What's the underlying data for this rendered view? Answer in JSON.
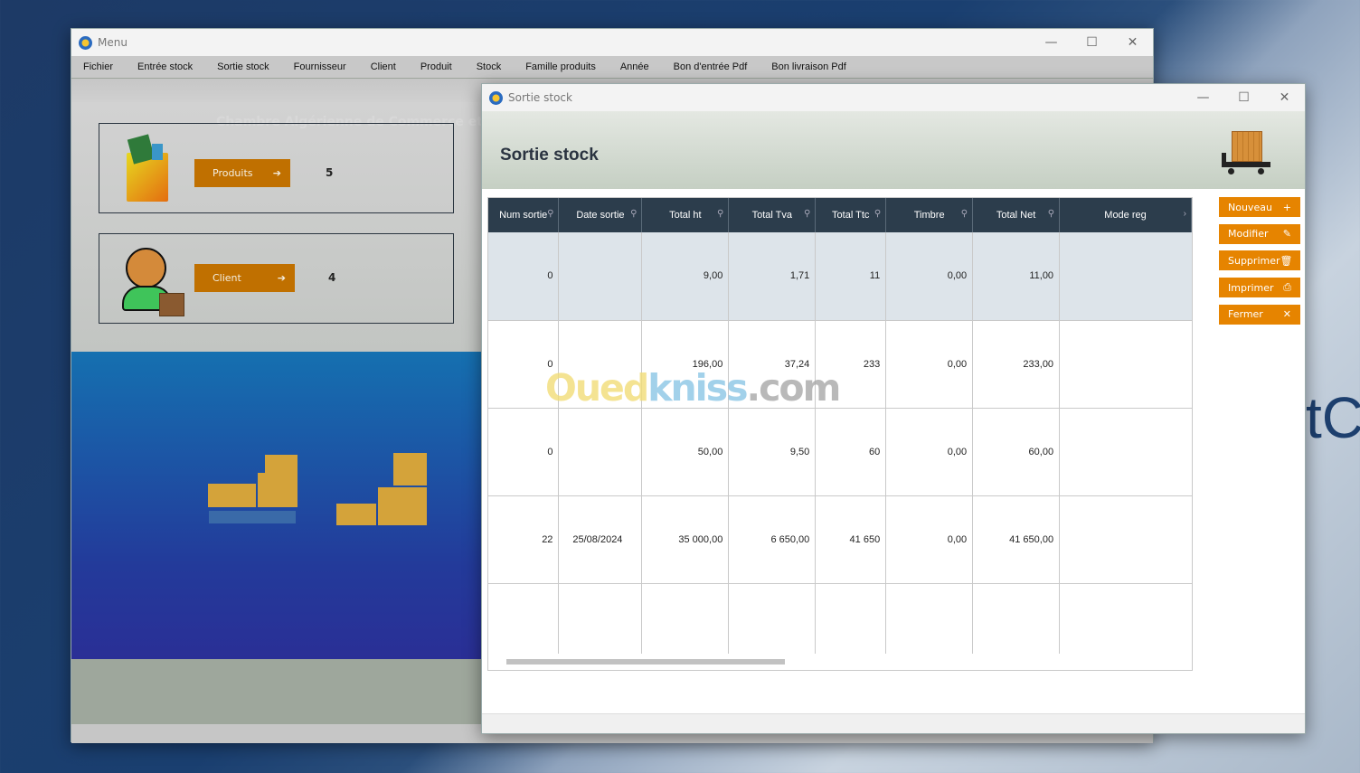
{
  "desktop": {
    "text": "tC"
  },
  "menu_window": {
    "title": "Menu",
    "menu": [
      "Fichier",
      "Entrée stock",
      "Sortie stock",
      "Fournisseur",
      "Client",
      "Produit",
      "Stock",
      "Famille produits",
      "Année",
      "Bon d'entrée Pdf",
      "Bon livraison Pdf"
    ],
    "banner_text": "Chambre Algérienne de Commerce et d",
    "cards": [
      {
        "label": "Produits",
        "count": "5",
        "icon": "shopping-bag-icon"
      },
      {
        "label": "Client",
        "count": "4",
        "icon": "client-icon"
      }
    ]
  },
  "sortie_window": {
    "title": "Sortie stock",
    "heading": "Sortie stock",
    "columns": [
      "Num sortie",
      "Date sortie",
      "Total ht",
      "Total Tva",
      "Total Ttc",
      "Timbre",
      "Total Net",
      "Mode reg"
    ],
    "rows": [
      [
        "0",
        "",
        "9,00",
        "1,71",
        "11",
        "0,00",
        "11,00",
        ""
      ],
      [
        "0",
        "",
        "196,00",
        "37,24",
        "233",
        "0,00",
        "233,00",
        ""
      ],
      [
        "0",
        "",
        "50,00",
        "9,50",
        "60",
        "0,00",
        "60,00",
        ""
      ],
      [
        "22",
        "25/08/2024",
        "35 000,00",
        "6 650,00",
        "41 650",
        "0,00",
        "41 650,00",
        ""
      ]
    ],
    "buttons": [
      {
        "label": "Nouveau",
        "icon": "+"
      },
      {
        "label": "Modifier",
        "icon": "✎"
      },
      {
        "label": "Supprimer",
        "icon": "🗑"
      },
      {
        "label": "Imprimer",
        "icon": "⎙"
      },
      {
        "label": "Fermer",
        "icon": "✕"
      }
    ]
  },
  "watermark": {
    "part1": "Oued",
    "part2": "kniss",
    "part3": ".com"
  },
  "colors": {
    "accent": "#e68400",
    "header": "#2c3d4c"
  }
}
